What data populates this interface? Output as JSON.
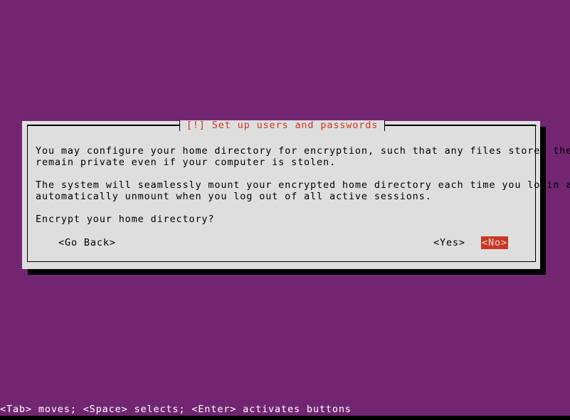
{
  "screen": {
    "background_color": "#722672",
    "foreground_color": "#ffffff"
  },
  "dialog": {
    "title": "[!] Set up users and passwords",
    "title_color": "#cc3722",
    "background_color": "#dedede",
    "border_color": "#000000",
    "paragraphs": [
      "You may configure your home directory for encryption, such that any files stored there\nremain private even if your computer is stolen.",
      "The system will seamlessly mount your encrypted home directory each time you login and\nautomatically unmount when you log out of all active sessions.",
      "Encrypt your home directory?"
    ],
    "buttons": [
      {
        "label": "<Go Back>",
        "selected": false
      },
      {
        "label": "<Yes>",
        "selected": false
      },
      {
        "label": "<No>",
        "selected": true
      }
    ],
    "selected_button_background": "#cc3722",
    "selected_button_foreground": "#dedede"
  },
  "help_bar": {
    "text": "<Tab> moves; <Space> selects; <Enter> activates buttons"
  }
}
